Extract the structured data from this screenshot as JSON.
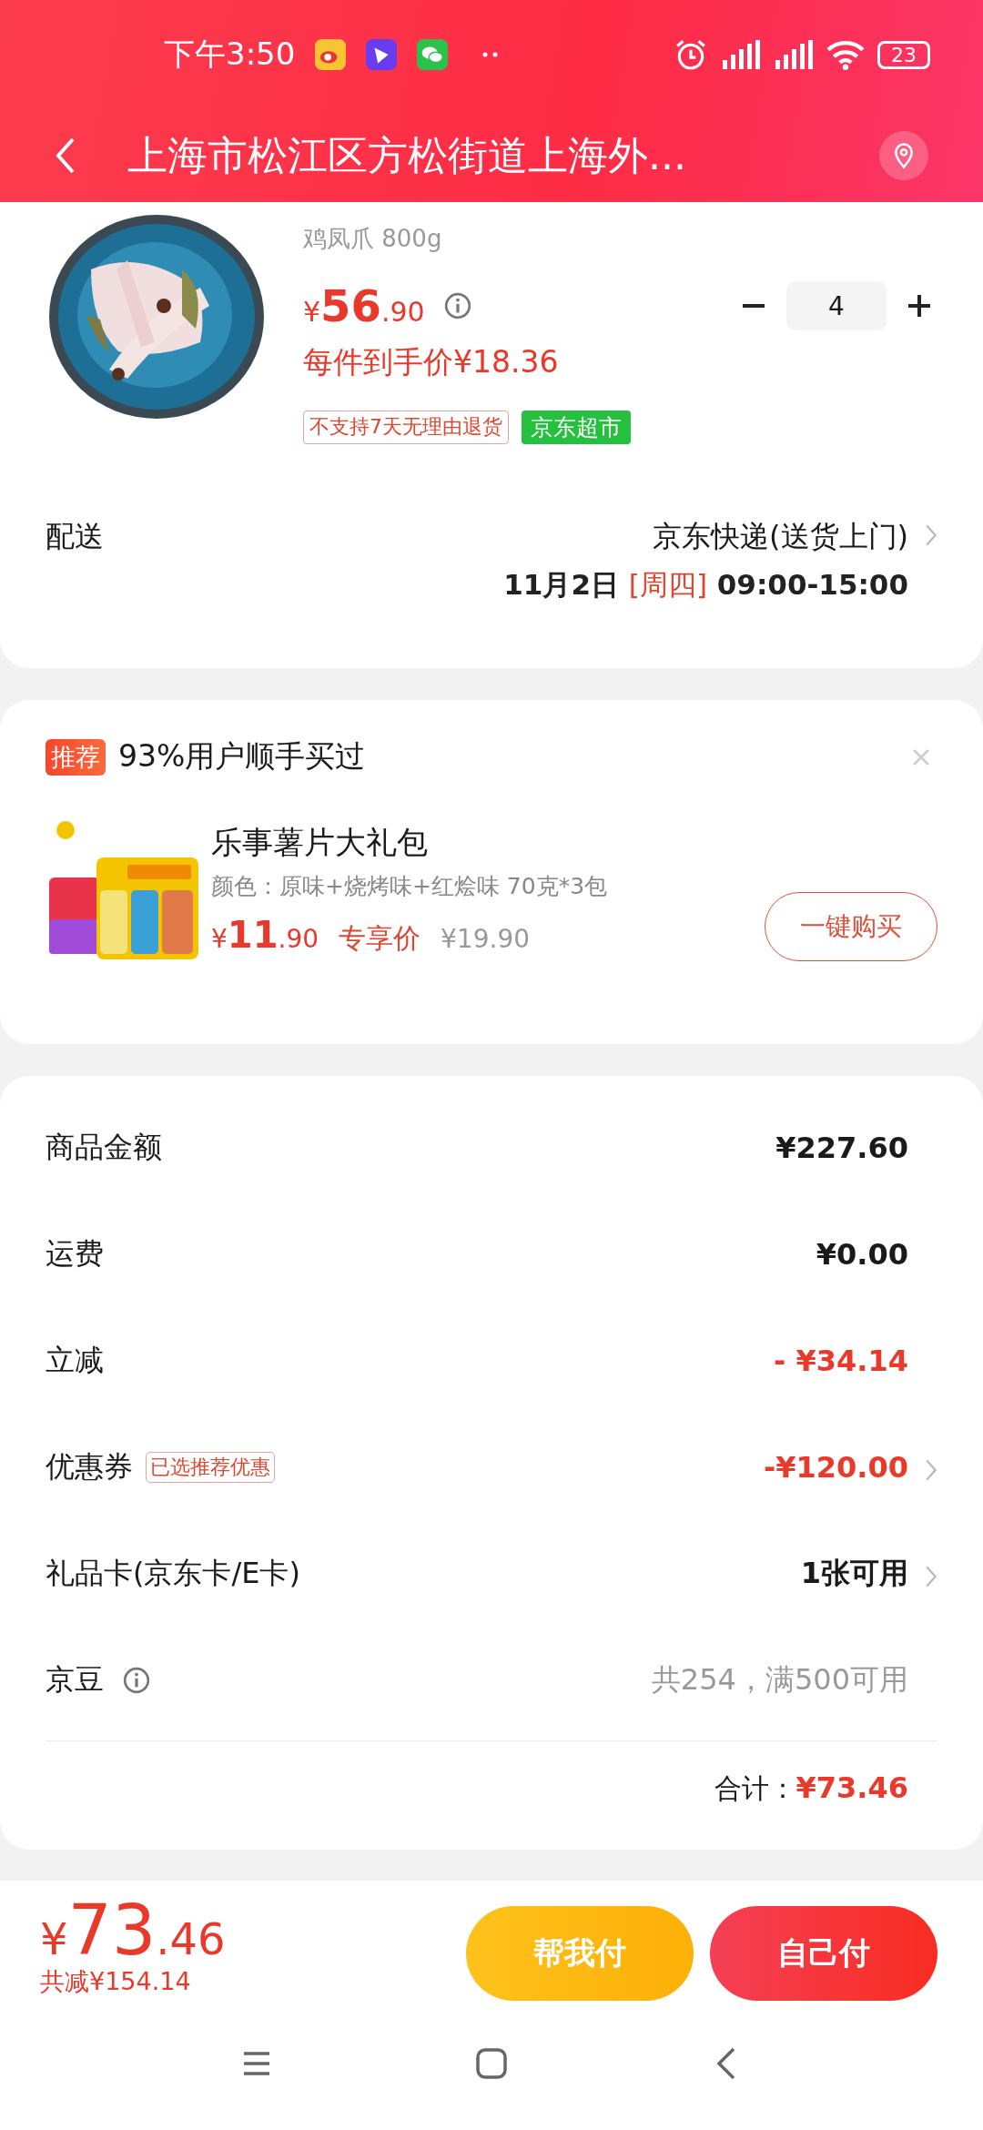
{
  "status_bar": {
    "time": "下午3:50",
    "battery": "23"
  },
  "header": {
    "title": "上海市松江区方松街道上海外..."
  },
  "product": {
    "variant": "鸡凤爪 800g",
    "currency": "¥",
    "price_int": "56",
    "price_dec": ".90",
    "quantity": "4",
    "unit_price": "每件到手价¥18.36",
    "tags": [
      {
        "label": "不支持7天无理由退货",
        "kind": "outline"
      },
      {
        "label": "京东超市",
        "kind": "filled"
      }
    ]
  },
  "delivery": {
    "label": "配送",
    "method": "京东快递(送货上门)",
    "date": "11月2日",
    "weekday": "[周四]",
    "time": "09:00-15:00",
    "has_arrow": true
  },
  "recommend": {
    "badge": "推荐",
    "title": "93%用户顺手买过",
    "name": "乐事薯片大礼包",
    "spec": "颜色：原味+烧烤味+红烩味 70克*3包",
    "currency": "¥",
    "price_int": "11",
    "price_dec": ".90",
    "price_label": "专享价",
    "original_price": "¥19.90",
    "button": "一键购买"
  },
  "summary": {
    "rows": [
      {
        "label": "商品金额",
        "value": "¥227.60",
        "kind": "plain",
        "has_arrow": false,
        "info": false
      },
      {
        "label": "运费",
        "value": "¥0.00",
        "kind": "plain",
        "has_arrow": false,
        "info": false
      },
      {
        "label": "立减",
        "value": "- ¥34.14",
        "kind": "discount",
        "has_arrow": false,
        "info": false
      },
      {
        "label": "优惠券",
        "tag": "已选推荐优惠",
        "value": "-¥120.00",
        "kind": "discount",
        "has_arrow": true,
        "info": false
      },
      {
        "label": "礼品卡(京东卡/E卡)",
        "value": "1张可用",
        "kind": "plain",
        "has_arrow": true,
        "info": false
      },
      {
        "label": "京豆",
        "value": "共254，满500可用",
        "kind": "muted",
        "has_arrow": false,
        "info": true
      }
    ],
    "total_label": "合计：",
    "total_value": "¥73.46"
  },
  "footer": {
    "currency": "¥",
    "price_int": "73",
    "price_dec": ".46",
    "saved": "共减¥154.14",
    "buttons": [
      {
        "label": "帮我付",
        "kind": "secondary"
      },
      {
        "label": "自己付",
        "kind": "primary"
      }
    ]
  }
}
